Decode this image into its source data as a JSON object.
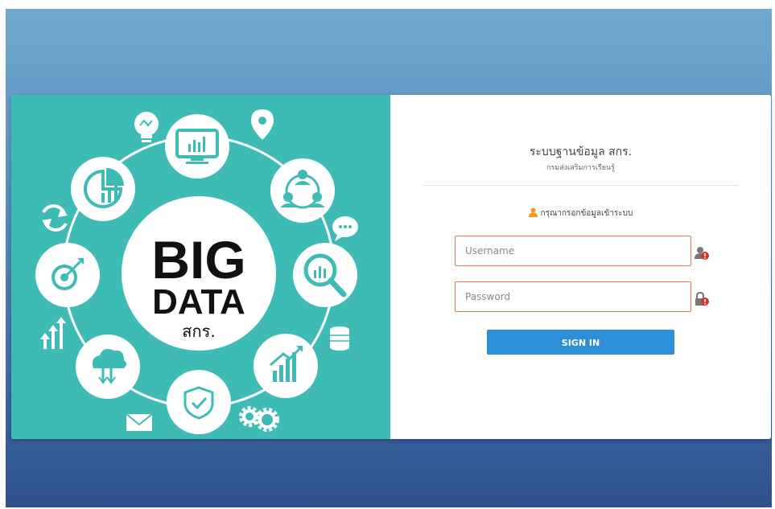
{
  "hero": {
    "big_text": "BIG",
    "data_text": "DATA",
    "org_text": "สกร."
  },
  "login": {
    "title": "ระบบฐานข้อมูล สกร.",
    "subtitle": "กรมส่งเสริมการเรียนรู้",
    "prompt": "กรุณากรอกข้อมูลเข้าระบบ",
    "username_placeholder": "Username",
    "password_placeholder": "Password",
    "signin_label": "SIGN IN"
  },
  "colors": {
    "hero_bg": "#3ebbb4",
    "button": "#2d8fd5",
    "field_border": "#e2775d",
    "accent_icon": "#f29a1f",
    "error_badge": "#d9352b"
  },
  "icons": [
    "user-icon",
    "user-alert-icon",
    "lock-alert-icon",
    "lightbulb-icon",
    "monitor-chart-icon",
    "map-pin-icon",
    "network-people-icon",
    "chat-bubble-icon",
    "magnify-chart-icon",
    "database-icon",
    "growth-chart-icon",
    "gears-icon",
    "shield-check-icon",
    "mail-icon",
    "cloud-download-icon",
    "arrows-up-icon",
    "target-icon",
    "refresh-icon",
    "pie-chart-icon"
  ]
}
